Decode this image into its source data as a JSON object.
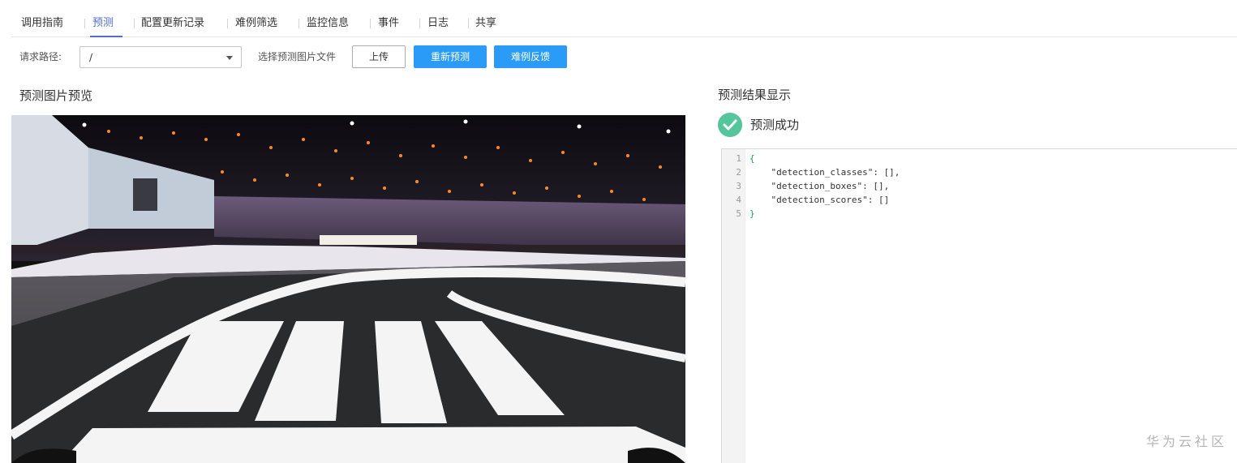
{
  "tabs": [
    {
      "label": "调用指南",
      "active": false
    },
    {
      "label": "预测",
      "active": true
    },
    {
      "label": "配置更新记录",
      "active": false
    },
    {
      "label": "难例筛选",
      "active": false
    },
    {
      "label": "监控信息",
      "active": false
    },
    {
      "label": "事件",
      "active": false
    },
    {
      "label": "日志",
      "active": false
    },
    {
      "label": "共享",
      "active": false
    }
  ],
  "toolbar": {
    "path_label": "请求路径:",
    "path_value": "/",
    "file_label": "选择预测图片文件",
    "upload_label": "上传",
    "repredict_label": "重新预测",
    "feedback_label": "难例反馈"
  },
  "preview": {
    "title": "预测图片预览"
  },
  "result": {
    "title": "预测结果显示",
    "status": "预测成功",
    "status_color": "#55c59c",
    "line_numbers": [
      "1",
      "2",
      "3",
      "4",
      "5"
    ],
    "lines": [
      "{",
      "    \"detection_classes\": [],",
      "    \"detection_boxes\": [],",
      "    \"detection_scores\": []",
      "}"
    ]
  },
  "watermark": "华为云社区",
  "colors": {
    "accent": "#526ecc",
    "primary_button": "#2b9bf8",
    "success": "#55c59c"
  }
}
